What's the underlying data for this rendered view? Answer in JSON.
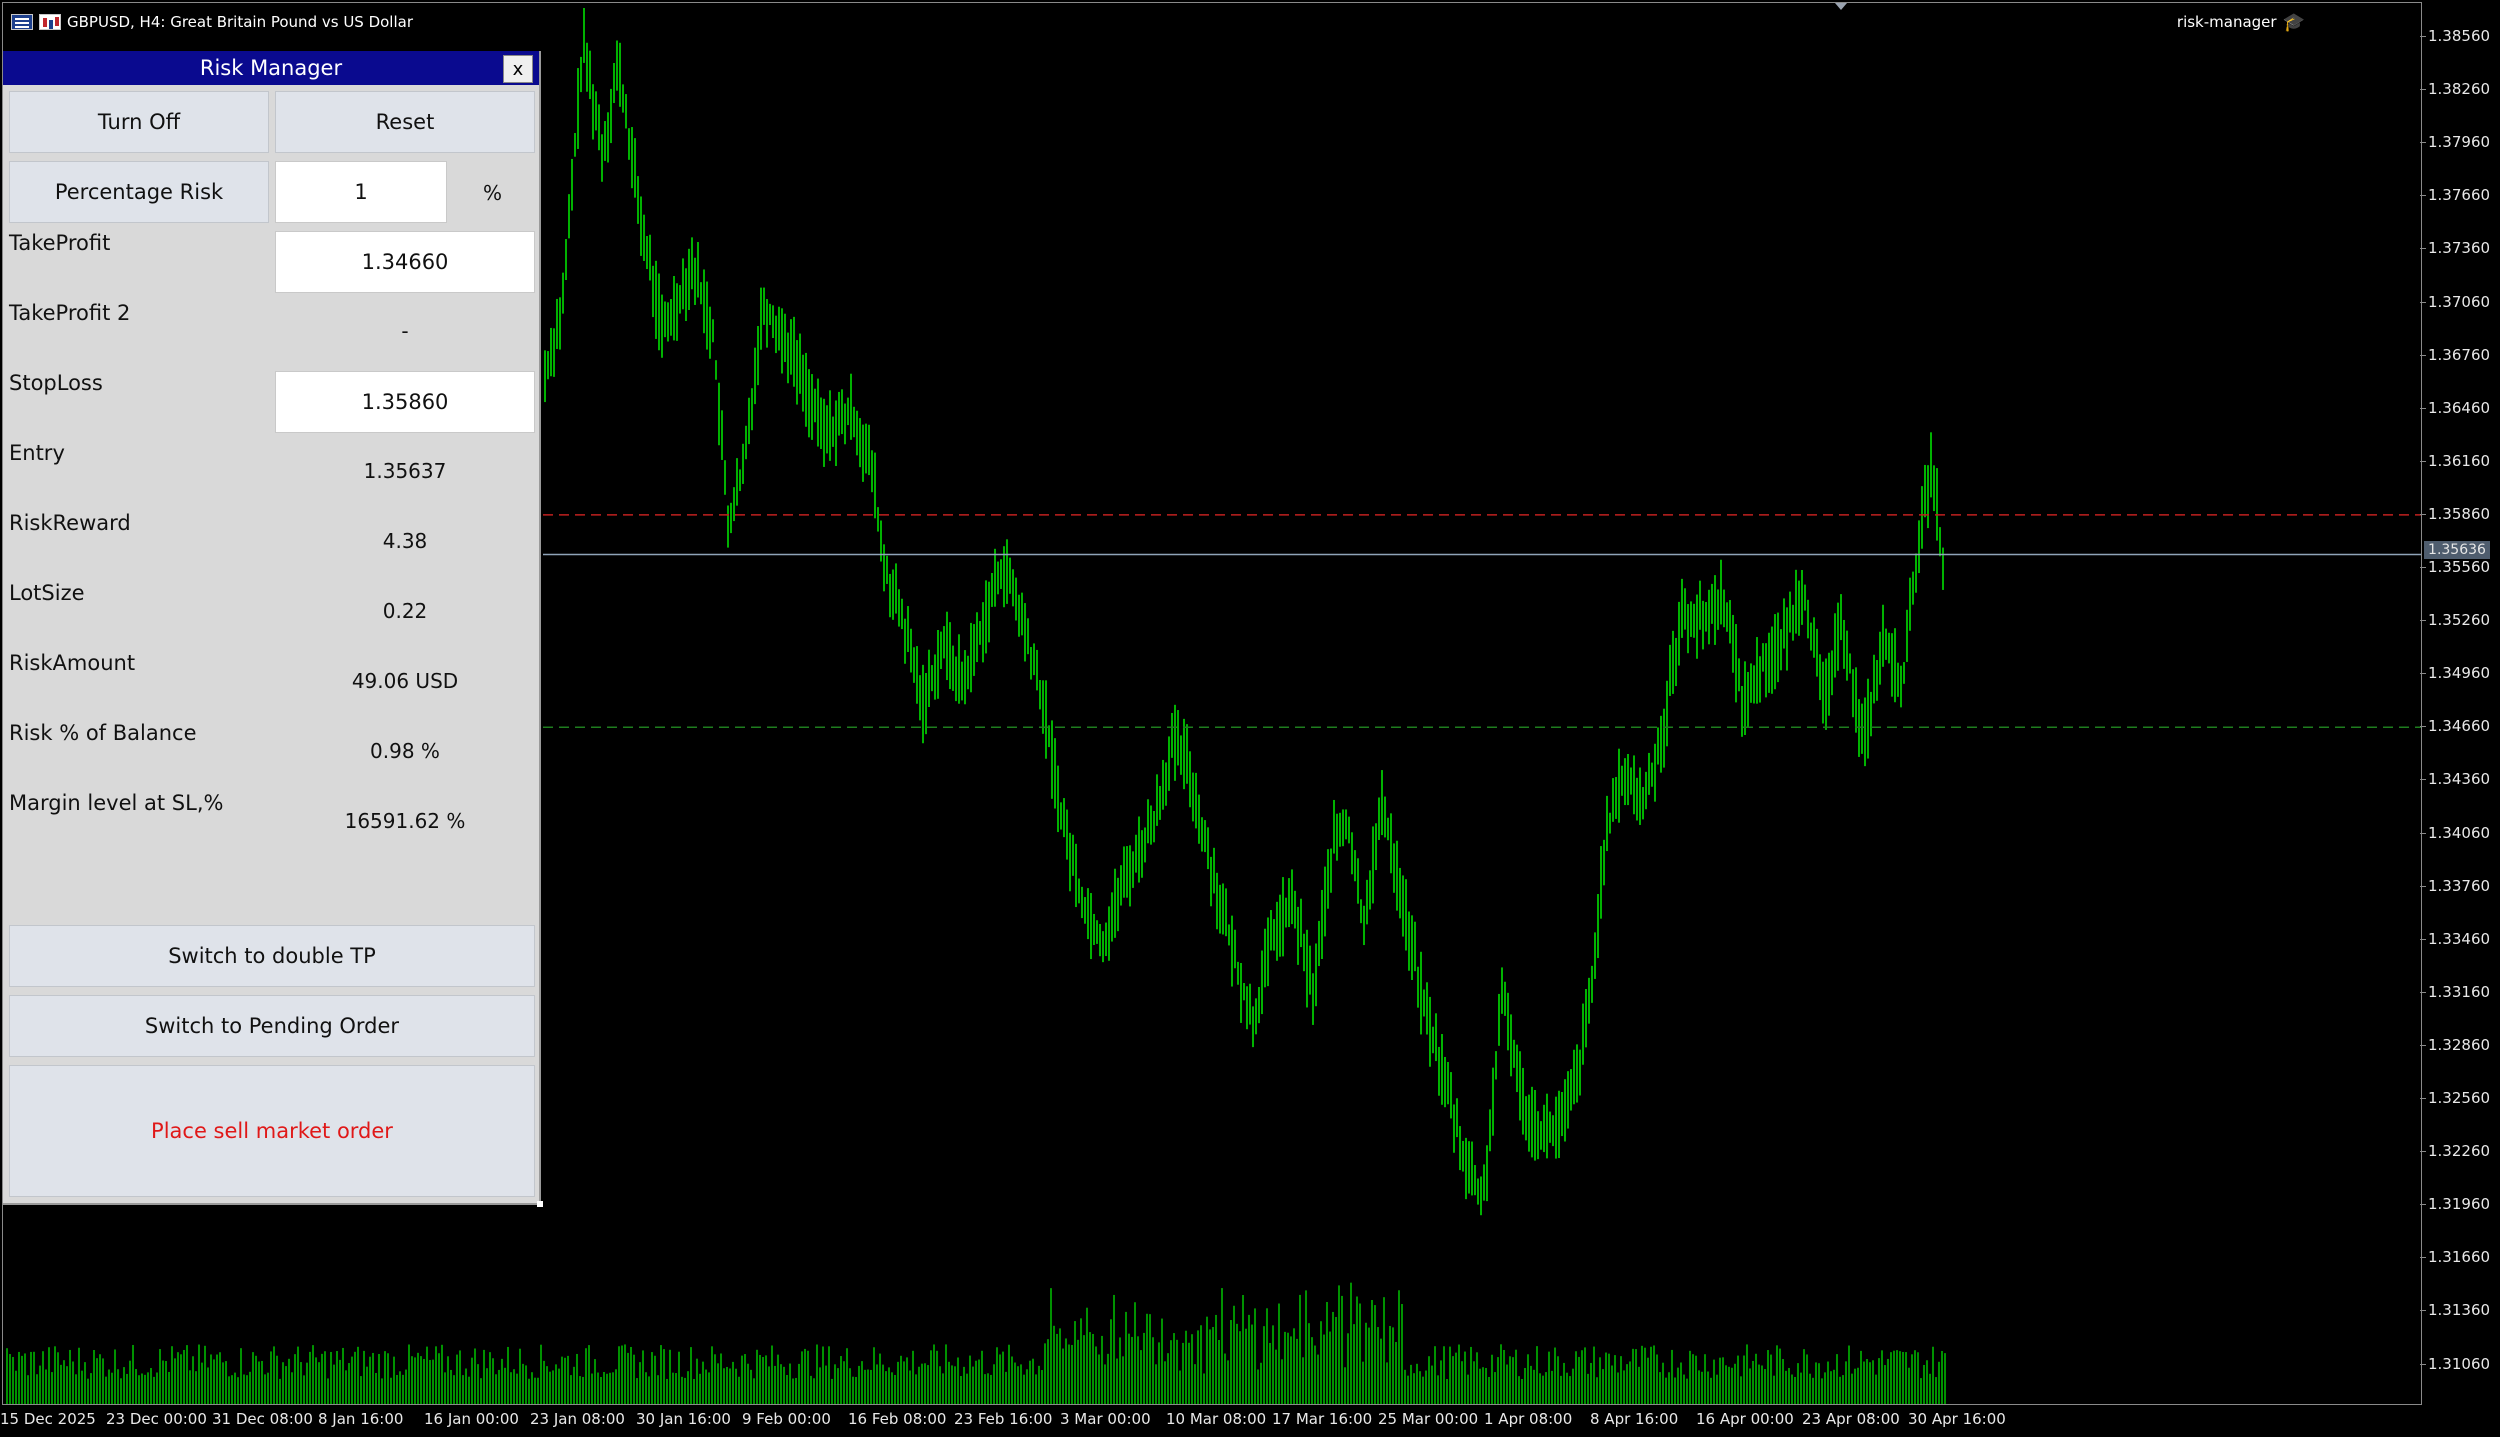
{
  "window": {
    "symbol_line": "GBPUSD, H4:  Great Britain Pound vs US Dollar",
    "ea_name": "risk-manager",
    "icons": [
      "list-icon",
      "bars-icon",
      "graduation-cap-icon"
    ]
  },
  "price_axis": {
    "labels": [
      "1.38560",
      "1.38260",
      "1.37960",
      "1.37660",
      "1.37360",
      "1.37060",
      "1.36760",
      "1.36460",
      "1.36160",
      "1.35860",
      "1.35560",
      "1.35260",
      "1.34960",
      "1.34660",
      "1.34360",
      "1.34060",
      "1.33760",
      "1.33460",
      "1.33160",
      "1.32860",
      "1.32560",
      "1.32260",
      "1.31960",
      "1.31660",
      "1.31360",
      "1.31060"
    ],
    "current_price": "1.35636"
  },
  "time_axis": {
    "labels": [
      "15 Dec 2025",
      "23 Dec 00:00",
      "31 Dec 08:00",
      "8 Jan 16:00",
      "16 Jan 00:00",
      "23 Jan 08:00",
      "30 Jan 16:00",
      "9 Feb 00:00",
      "16 Feb 08:00",
      "23 Feb 16:00",
      "3 Mar 00:00",
      "10 Mar 08:00",
      "17 Mar 16:00",
      "25 Mar 00:00",
      "1 Apr 08:00",
      "8 Apr 16:00",
      "16 Apr 00:00",
      "23 Apr 08:00",
      "30 Apr 16:00"
    ]
  },
  "chart_lines": {
    "stoploss_price": 1.3586,
    "takeprofit_price": 1.3466,
    "current_price": 1.35636,
    "stoploss_color": "#c0201f",
    "takeprofit_color": "#1e7d1e",
    "current_color": "#8fa3b8",
    "candle_color": "#00e000"
  },
  "risk_manager": {
    "title": "Risk Manager",
    "close_label": "x",
    "turn_off_label": "Turn Off",
    "reset_label": "Reset",
    "percentage_risk_label": "Percentage Risk",
    "percentage_risk_value": "1",
    "percent_unit": "%",
    "takeprofit_label": "TakeProfit",
    "takeprofit_value": "1.34660",
    "takeprofit2_label": "TakeProfit 2",
    "takeprofit2_value": "-",
    "stoploss_label": "StopLoss",
    "stoploss_value": "1.35860",
    "entry_label": "Entry",
    "entry_value": "1.35637",
    "riskreward_label": "RiskReward",
    "riskreward_value": "4.38",
    "lotsize_label": "LotSize",
    "lotsize_value": "0.22",
    "riskamount_label": "RiskAmount",
    "riskamount_value": "49.06 USD",
    "risk_balance_label": "Risk % of Balance",
    "risk_balance_value": "0.98 %",
    "margin_label": "Margin level at SL,%",
    "margin_value": "16591.62 %",
    "double_tp_label": "Switch to double TP",
    "pending_label": "Switch to Pending Order",
    "place_order_label": "Place sell market order",
    "place_order_color": "#e01818"
  }
}
